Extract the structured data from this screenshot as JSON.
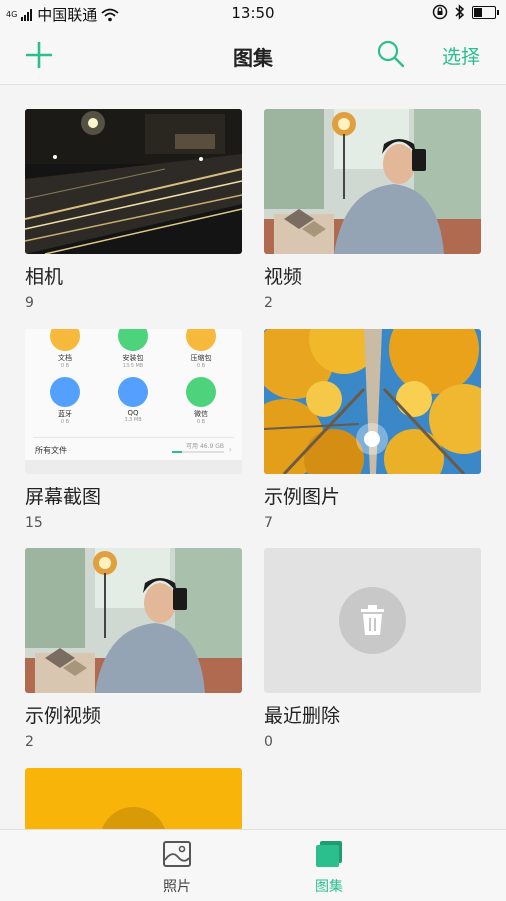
{
  "status_bar": {
    "signal_label": "4G",
    "carrier": "中国联通",
    "time": "13:50",
    "battery_level": 0.45
  },
  "header": {
    "title": "图集",
    "select_label": "选择",
    "add_icon": "plus-icon",
    "search_icon": "search-icon"
  },
  "albums": [
    {
      "name": "相机",
      "count": "9",
      "thumb": "night-city-traffic"
    },
    {
      "name": "视频",
      "count": "2",
      "thumb": "man-with-phone-and-lamp"
    },
    {
      "name": "屏幕截图",
      "count": "15",
      "thumb": "file-manager-screenshot"
    },
    {
      "name": "示例图片",
      "count": "7",
      "thumb": "autumn-forest-sunburst"
    },
    {
      "name": "示例视频",
      "count": "2",
      "thumb": "man-with-phone-and-lamp"
    },
    {
      "name": "最近删除",
      "count": "0",
      "thumb": "trash-icon"
    },
    {
      "name": "",
      "count": "",
      "thumb": "yellow-album-cover"
    }
  ],
  "screenshot_thumb": {
    "apps": [
      {
        "name": "文档",
        "size": "0 B",
        "color": "#f6b93b"
      },
      {
        "name": "安装包",
        "size": "13.5 MB",
        "color": "#4cd37b"
      },
      {
        "name": "压缩包",
        "size": "0 B",
        "color": "#f6b93b"
      },
      {
        "name": "蓝牙",
        "size": "0 B",
        "color": "#54a0ff"
      },
      {
        "name": "QQ",
        "size": "3.3 MB",
        "color": "#54a0ff"
      },
      {
        "name": "微信",
        "size": "0 B",
        "color": "#4cd37b"
      }
    ],
    "all_files_label": "所有文件",
    "available_label": "可用 46.9 GB"
  },
  "tabs": [
    {
      "label": "照片",
      "active": false
    },
    {
      "label": "图集",
      "active": true
    }
  ],
  "colors": {
    "accent": "#2bbf8d",
    "background": "#f4f4f4",
    "bar": "#f7f7f7"
  }
}
